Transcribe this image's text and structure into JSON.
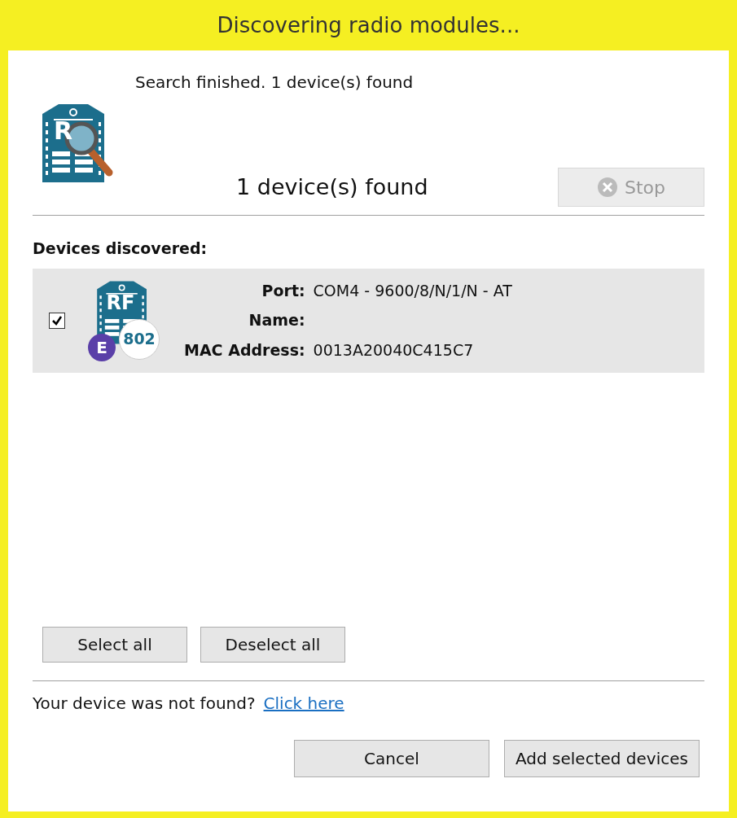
{
  "window": {
    "title": "Discovering radio modules..."
  },
  "status": {
    "message": "Search finished. 1 device(s) found",
    "icon_label": "R",
    "count": "1 device(s) found"
  },
  "stop_button": {
    "label": "Stop",
    "disabled": true
  },
  "devices": {
    "heading": "Devices discovered:",
    "items": [
      {
        "checked": true,
        "icon_label": "RF",
        "badge_protocol": "802",
        "badge_letter": "E",
        "fields": [
          {
            "label": "Port:",
            "value": "COM4 - 9600/8/N/1/N - AT"
          },
          {
            "label": "Name:"
          },
          {
            "label": "MAC Address:",
            "value": "0013A20040C415C7"
          }
        ]
      }
    ]
  },
  "selection_buttons": [
    "Select all",
    "Deselect all"
  ],
  "help": {
    "text": "Your device was not found?",
    "link": "Click here"
  },
  "buttons": [
    "Cancel",
    "Add selected devices"
  ]
}
